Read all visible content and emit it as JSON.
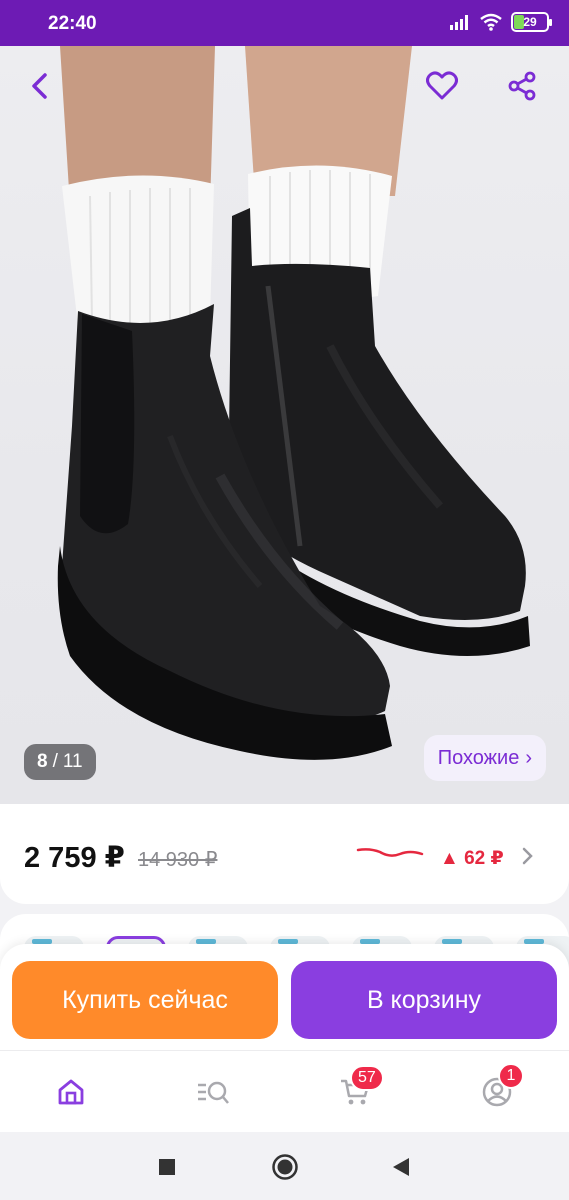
{
  "status_bar": {
    "time": "22:40",
    "battery": "29",
    "icons": [
      "signal-icon",
      "wifi-icon",
      "battery-icon"
    ]
  },
  "gallery": {
    "current": "8",
    "separator": "/",
    "total": "11",
    "similar_label": "Похожие",
    "similar_chevron": "›"
  },
  "header": {
    "icons": [
      "back-icon",
      "heart-icon",
      "share-icon"
    ]
  },
  "price": {
    "current": "2 759 ₽",
    "old": "14 930 ₽",
    "change": "▲ 62 ₽"
  },
  "actions": {
    "buy_now": "Купить сейчас",
    "add_to_cart": "В корзину"
  },
  "bottom_nav": {
    "items": [
      {
        "name": "home-icon",
        "active": true
      },
      {
        "name": "catalog-search-icon",
        "active": false
      },
      {
        "name": "cart-icon",
        "active": false,
        "badge": "57"
      },
      {
        "name": "profile-icon",
        "active": false,
        "badge": "1"
      }
    ]
  },
  "system_nav": {
    "icons": [
      "recents-icon",
      "home-circle-icon",
      "back-triangle-icon"
    ]
  },
  "colors": {
    "brand_purple": "#8a3ee0",
    "status_purple": "#6d1bb4",
    "buy_orange": "#ff8a2a",
    "alert_red": "#e5283f"
  }
}
